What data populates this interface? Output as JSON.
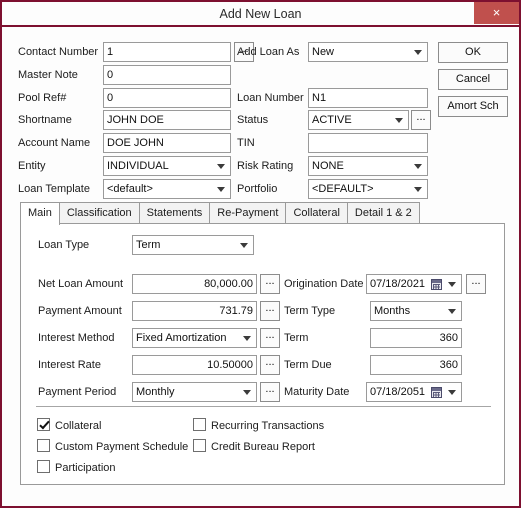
{
  "window": {
    "title": "Add New Loan",
    "close_label": "×",
    "accent_border": "#7d1030",
    "close_bg": "#c0504d"
  },
  "top_form": {
    "left_fields": [
      {
        "label": "Contact Number",
        "value": "1",
        "type": "text",
        "ellipsis": true
      },
      {
        "label": "Master Note",
        "value": "0",
        "type": "text",
        "ellipsis": false
      },
      {
        "label": "Pool Ref#",
        "value": "0",
        "type": "text",
        "ellipsis": false
      },
      {
        "label": "Shortname",
        "value": "JOHN DOE",
        "type": "text",
        "ellipsis": false
      },
      {
        "label": "Account Name",
        "value": "DOE JOHN",
        "type": "text",
        "ellipsis": false
      },
      {
        "label": "Entity",
        "value": "INDIVIDUAL",
        "type": "combo",
        "ellipsis": false
      },
      {
        "label": "Loan Template",
        "value": "<default>",
        "type": "combo",
        "ellipsis": false
      }
    ],
    "right_fields": [
      {
        "label": "Add Loan As",
        "value": "New",
        "type": "combo",
        "ellipsis": false
      },
      {
        "label": "Loan Number",
        "value": "N1",
        "type": "text",
        "ellipsis": false
      },
      {
        "label": "Status",
        "value": "ACTIVE",
        "type": "combo",
        "ellipsis": true
      },
      {
        "label": "TIN",
        "value": "",
        "type": "text",
        "ellipsis": false
      },
      {
        "label": "Risk Rating",
        "value": "NONE",
        "type": "combo",
        "ellipsis": false
      },
      {
        "label": "Portfolio",
        "value": "<DEFAULT>",
        "type": "combo",
        "ellipsis": false
      }
    ],
    "buttons": [
      {
        "label": "OK",
        "name": "ok-button"
      },
      {
        "label": "Cancel",
        "name": "cancel-button"
      },
      {
        "label": "Amort Sch",
        "name": "amort-sch-button"
      }
    ]
  },
  "tabs": [
    {
      "label": "Main",
      "active": true
    },
    {
      "label": "Classification",
      "active": false
    },
    {
      "label": "Statements",
      "active": false
    },
    {
      "label": "Re-Payment",
      "active": false
    },
    {
      "label": "Collateral",
      "active": false
    },
    {
      "label": "Detail 1 & 2",
      "active": false
    }
  ],
  "main_tab": {
    "loan_type": {
      "label": "Loan Type",
      "value": "Term"
    },
    "left_fields": [
      {
        "label": "Net Loan Amount",
        "value": "80,000.00",
        "type": "text",
        "align": "right",
        "ellipsis": true
      },
      {
        "label": "Payment Amount",
        "value": "731.79",
        "type": "text",
        "align": "right",
        "ellipsis": true
      },
      {
        "label": "Interest Method",
        "value": "Fixed Amortization",
        "type": "combo",
        "align": "left",
        "ellipsis": true
      },
      {
        "label": "Interest Rate",
        "value": "10.50000",
        "type": "text",
        "align": "right",
        "ellipsis": true
      },
      {
        "label": "Payment Period",
        "value": "Monthly",
        "type": "combo",
        "align": "left",
        "ellipsis": true
      }
    ],
    "right_fields": [
      {
        "label": "Origination Date",
        "value": "07/18/2021",
        "type": "date",
        "align": "left",
        "ellipsis": true
      },
      {
        "label": "Term Type",
        "value": "Months",
        "type": "combo",
        "align": "left",
        "ellipsis": false
      },
      {
        "label": "Term",
        "value": "360",
        "type": "text",
        "align": "right",
        "ellipsis": false
      },
      {
        "label": "Term Due",
        "value": "360",
        "type": "text",
        "align": "right",
        "ellipsis": false
      },
      {
        "label": "Maturity Date",
        "value": "07/18/2051",
        "type": "date",
        "align": "left",
        "ellipsis": false
      }
    ],
    "checkboxes": [
      {
        "label": "Collateral",
        "checked": true,
        "col": 0,
        "row": 0
      },
      {
        "label": "Custom Payment Schedule",
        "checked": false,
        "col": 0,
        "row": 1
      },
      {
        "label": "Participation",
        "checked": false,
        "col": 0,
        "row": 2
      },
      {
        "label": "Recurring Transactions",
        "checked": false,
        "col": 1,
        "row": 0
      },
      {
        "label": "Credit Bureau Report",
        "checked": false,
        "col": 1,
        "row": 1
      }
    ]
  }
}
